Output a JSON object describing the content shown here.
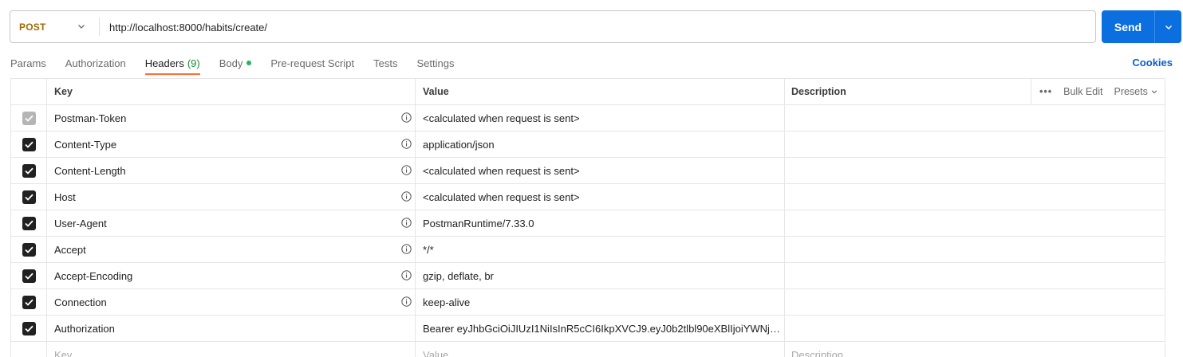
{
  "request": {
    "method": "POST",
    "url": "http://localhost:8000/habits/create/",
    "send_label": "Send"
  },
  "tabs": [
    {
      "label": "Params"
    },
    {
      "label": "Authorization"
    },
    {
      "label": "Headers",
      "count": "(9)"
    },
    {
      "label": "Body"
    },
    {
      "label": "Pre-request Script"
    },
    {
      "label": "Tests"
    },
    {
      "label": "Settings"
    }
  ],
  "cookies_label": "Cookies",
  "table": {
    "col_key": "Key",
    "col_value": "Value",
    "col_description": "Description",
    "bulk_edit": "Bulk Edit",
    "presets": "Presets",
    "more": "•••",
    "rows": [
      {
        "key": "Postman-Token",
        "value": "<calculated when request is sent>",
        "checked": true,
        "disabled": true
      },
      {
        "key": "Content-Type",
        "value": "application/json",
        "checked": true
      },
      {
        "key": "Content-Length",
        "value": "<calculated when request is sent>",
        "checked": true
      },
      {
        "key": "Host",
        "value": "<calculated when request is sent>",
        "checked": true
      },
      {
        "key": "User-Agent",
        "value": "PostmanRuntime/7.33.0",
        "checked": true
      },
      {
        "key": "Accept",
        "value": "*/*",
        "checked": true
      },
      {
        "key": "Accept-Encoding",
        "value": "gzip, deflate, br",
        "checked": true
      },
      {
        "key": "Connection",
        "value": "keep-alive",
        "checked": true
      },
      {
        "key": "Authorization",
        "value": "Bearer eyJhbGciOiJIUzI1NiIsInR5cCI6IkpXVCJ9.eyJ0b2tlbl90eXBlIjoiYWNjZX...",
        "checked": true
      }
    ],
    "new_row": {
      "key_placeholder": "Key",
      "value_placeholder": "Value",
      "description_placeholder": "Description"
    }
  },
  "colors": {
    "accent": "#ff6c37",
    "send": "#0b6fe0",
    "method": "#a06a00",
    "link": "#0b5ed0"
  }
}
